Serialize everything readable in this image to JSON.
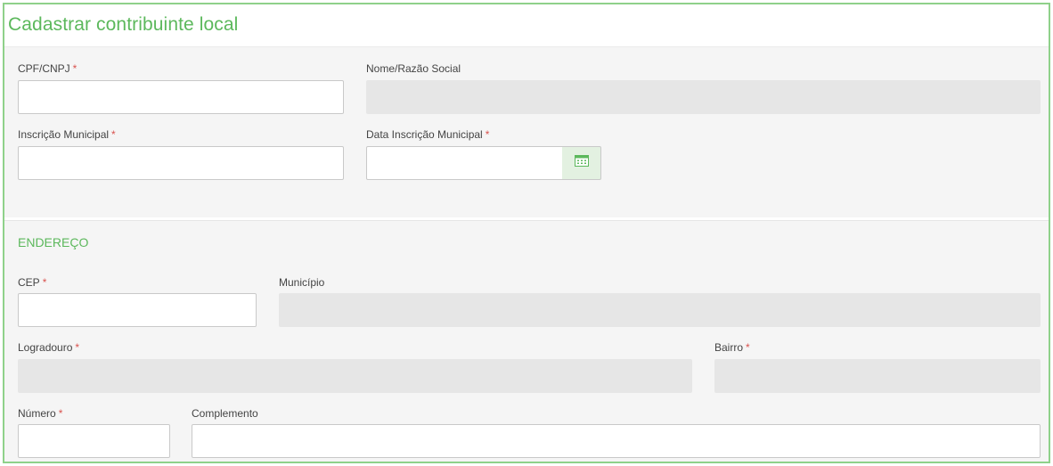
{
  "form": {
    "title": "Cadastrar contribuinte local",
    "required_mark": "*",
    "identification": {
      "cpf_cnpj": {
        "label": "CPF/CNPJ",
        "value": "",
        "required": true
      },
      "nome_razao_social": {
        "label": "Nome/Razão Social",
        "value": "",
        "readonly": true
      },
      "inscricao_municipal": {
        "label": "Inscrição Municipal",
        "value": "",
        "required": true
      },
      "data_inscricao_municipal": {
        "label": "Data Inscrição Municipal",
        "value": "",
        "required": true,
        "button_icon": "calendar-icon"
      }
    },
    "address": {
      "section_title": "ENDEREÇO",
      "cep": {
        "label": "CEP",
        "value": "",
        "required": true
      },
      "municipio": {
        "label": "Município",
        "value": "",
        "readonly": true
      },
      "logradouro": {
        "label": "Logradouro",
        "value": "",
        "required": true,
        "readonly": true
      },
      "bairro": {
        "label": "Bairro",
        "value": "",
        "required": true,
        "readonly": true
      },
      "numero": {
        "label": "Número",
        "value": "",
        "required": true
      },
      "complemento": {
        "label": "Complemento",
        "value": ""
      }
    }
  },
  "colors": {
    "accent": "#5cb85c",
    "frame_border": "#8fd18a",
    "required": "#d9534f",
    "readonly_bg": "#e6e6e6",
    "section_bg": "#f5f5f5"
  }
}
